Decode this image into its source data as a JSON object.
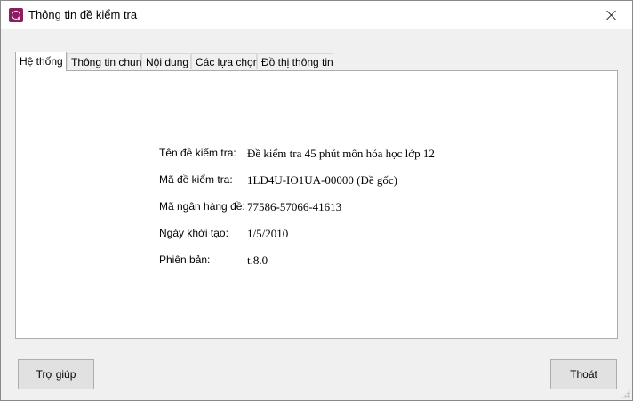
{
  "window": {
    "title": "Thông tin đề kiểm tra"
  },
  "tabs": [
    {
      "label": "Hệ thống",
      "active": true
    },
    {
      "label": "Thông tin chung",
      "active": false
    },
    {
      "label": "Nội dung",
      "active": false
    },
    {
      "label": "Các lựa chọn",
      "active": false
    },
    {
      "label": "Đồ thị thông tin",
      "active": false
    }
  ],
  "info": [
    {
      "label": "Tên đề kiểm tra:",
      "value": "Đề kiểm tra 45 phút môn hóa học lớp 12"
    },
    {
      "label": "Mã đề kiểm tra:",
      "value": "1LD4U-IO1UA-00000 (Đề gốc)"
    },
    {
      "label": "Mã ngân hàng đề:",
      "value": "77586-57066-41613"
    },
    {
      "label": "Ngày khởi tạo:",
      "value": "1/5/2010"
    },
    {
      "label": "Phiên bản:",
      "value": "t.8.0"
    }
  ],
  "buttons": {
    "help": "Trợ giúp",
    "exit": "Thoát"
  },
  "icons": {
    "app": "app-icon",
    "close": "close-icon"
  },
  "colors": {
    "app_icon": "#8b1e5e"
  }
}
